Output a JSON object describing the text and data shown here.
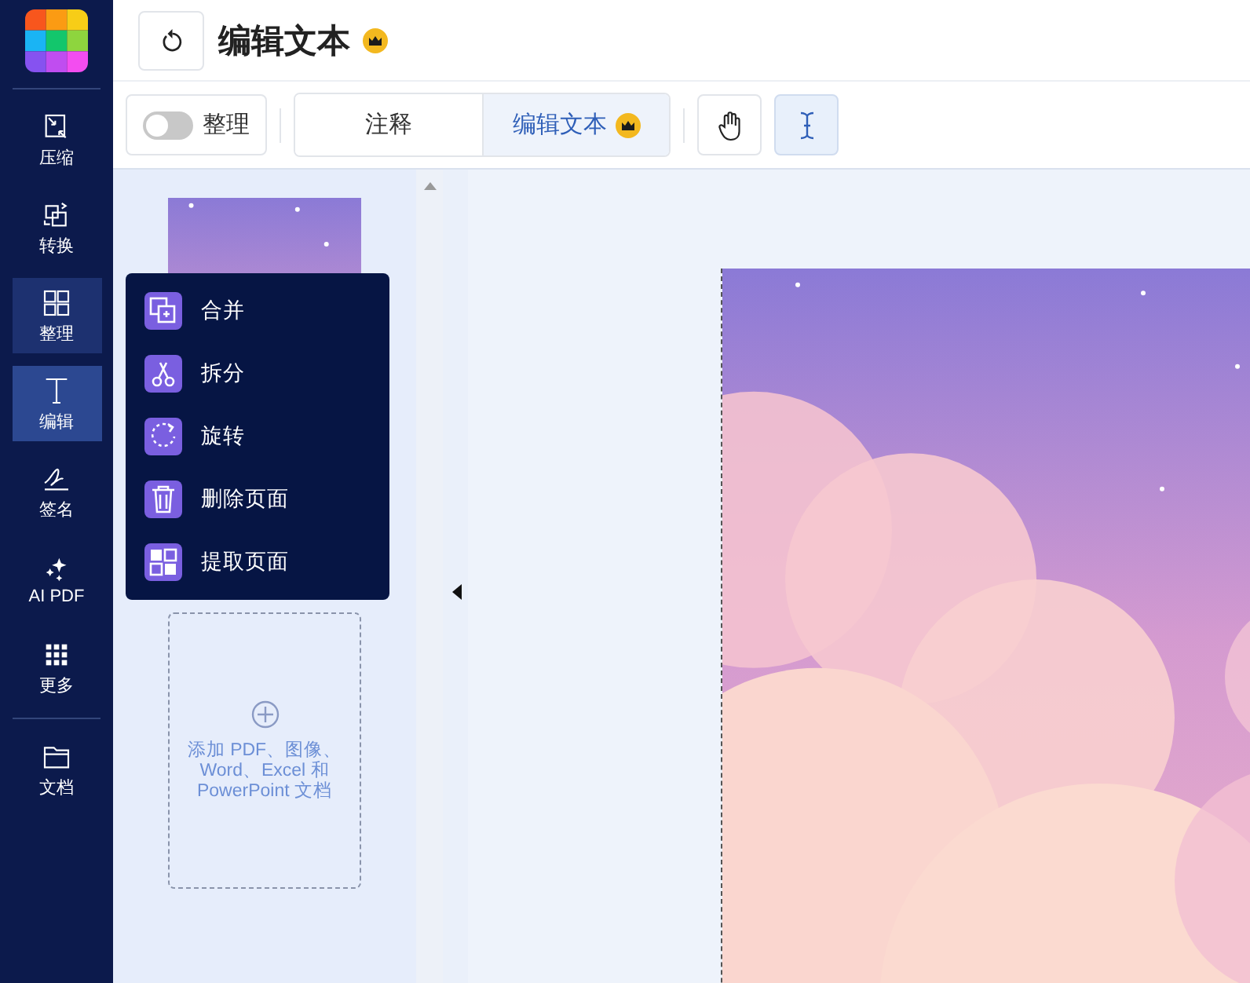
{
  "sidebar": {
    "items": [
      {
        "label": "压缩",
        "selected": false,
        "hovered": false
      },
      {
        "label": "转换",
        "selected": false,
        "hovered": false
      },
      {
        "label": "整理",
        "selected": false,
        "hovered": true
      },
      {
        "label": "编辑",
        "selected": true,
        "hovered": false
      },
      {
        "label": "签名",
        "selected": false,
        "hovered": false
      },
      {
        "label": "AI PDF",
        "selected": false,
        "hovered": false
      },
      {
        "label": "更多",
        "selected": false,
        "hovered": false
      },
      {
        "label": "文档",
        "selected": false,
        "hovered": false
      }
    ]
  },
  "header": {
    "title": "编辑文本",
    "premium": true
  },
  "toolbar": {
    "toggle": {
      "label": "整理",
      "on": false
    },
    "tabs": [
      {
        "label": "注释",
        "selected": false,
        "premium": false
      },
      {
        "label": "编辑文本",
        "selected": true,
        "premium": true
      }
    ],
    "tools": [
      {
        "kind": "hand",
        "selected": false
      },
      {
        "kind": "text-cursor",
        "selected": true
      }
    ]
  },
  "menu": {
    "items": [
      {
        "label": "合并"
      },
      {
        "label": "拆分"
      },
      {
        "label": "旋转"
      },
      {
        "label": "删除页面"
      },
      {
        "label": "提取页面"
      }
    ]
  },
  "add_box": {
    "text": "添加 PDF、图像、Word、Excel 和 PowerPoint 文档"
  }
}
